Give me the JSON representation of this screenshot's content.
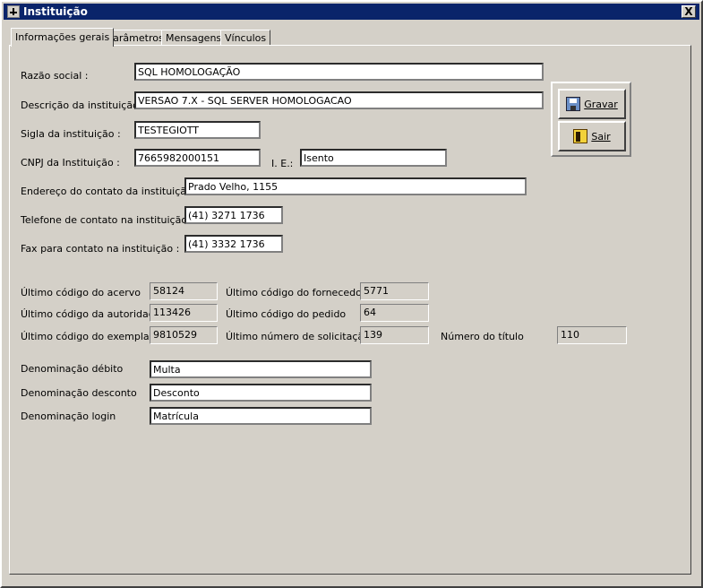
{
  "window": {
    "title": "Instituição",
    "close_label": "X"
  },
  "tabs": [
    "Informações gerais",
    "Parâmetros",
    "Mensagens",
    "Vínculos"
  ],
  "form": {
    "razao_label": "Razão social :",
    "razao_value": "SQL HOMOLOGAÇÃO",
    "descricao_label": "Descrição da instituição :",
    "descricao_value": "VERSAO 7.X - SQL SERVER HOMOLOGACAO",
    "sigla_label": "Sigla da instituição :",
    "sigla_value": "TESTEGIOTT",
    "cnpj_label": "CNPJ da Instituição :",
    "cnpj_value": "7665982000151",
    "ie_label": "I. E.:",
    "ie_value": "Isento",
    "endereco_label": "Endereço do contato da instituição :",
    "endereco_value": "Prado Velho, 1155",
    "telefone_label": "Telefone de contato na instituição :",
    "telefone_value": "(41) 3271 1736",
    "fax_label": "Fax para contato na instituição :",
    "fax_value": "(41) 3332 1736"
  },
  "codes": {
    "acervo_label": "Último código do acervo",
    "acervo_value": "58124",
    "autoridade_label": "Último código da autoridade",
    "autoridade_value": "113426",
    "exemplar_label": "Último código do exemplar",
    "exemplar_value": "9810529",
    "fornecedor_label": "Último código do fornecedor",
    "fornecedor_value": "5771",
    "pedido_label": "Último código do pedido",
    "pedido_value": "64",
    "solicitacao_label": "Último número de solicitação",
    "solicitacao_value": "139",
    "titulo_label": "Número do título",
    "titulo_value": "110"
  },
  "denominacoes": {
    "debito_label": "Denominação débito",
    "debito_value": "Multa",
    "desconto_label": "Denominação desconto",
    "desconto_value": "Desconto",
    "login_label": "Denominação login",
    "login_value": "Matrícula"
  },
  "buttons": {
    "save_label": "Gravar",
    "exit_label": "Sair"
  }
}
